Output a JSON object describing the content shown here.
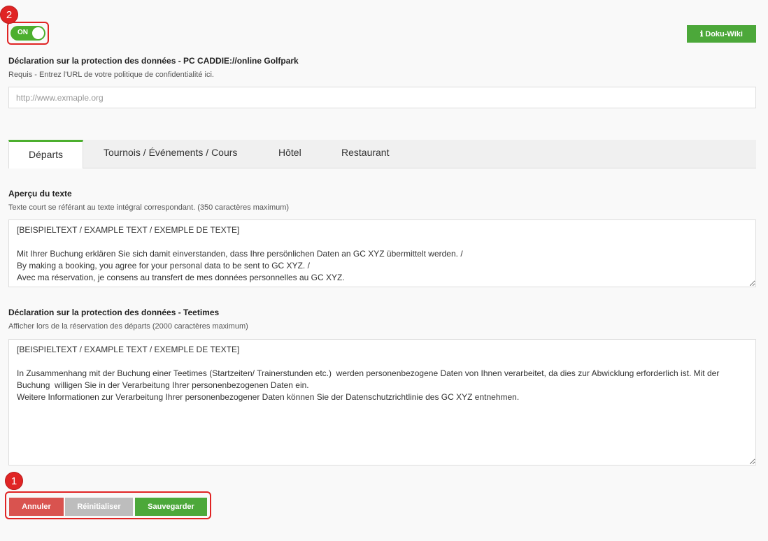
{
  "markers": {
    "one": "1",
    "two": "2"
  },
  "toggle": {
    "label": "ON",
    "state": "on"
  },
  "wiki_button": {
    "icon": "info-icon",
    "label": "ℹ Doku-Wiki"
  },
  "privacy_url": {
    "label": "Déclaration sur la protection des données - PC CADDIE://online Golfpark",
    "help": "Requis - Entrez l'URL de votre politique de confidentialité ici.",
    "placeholder": "http://www.exmaple.org",
    "value": ""
  },
  "tabs": [
    {
      "label": "Départs",
      "active": true
    },
    {
      "label": "Tournois / Événements / Cours",
      "active": false
    },
    {
      "label": "Hôtel",
      "active": false
    },
    {
      "label": "Restaurant",
      "active": false
    }
  ],
  "preview": {
    "label": "Aperçu du texte",
    "help": "Texte court se référant au texte intégral correspondant. (350 caractères maximum)",
    "value": "[BEISPIELTEXT / EXAMPLE TEXT / EXEMPLE DE TEXTE]\n\nMit Ihrer Buchung erklären Sie sich damit einverstanden, dass Ihre persönlichen Daten an GC XYZ übermittelt werden. /\nBy making a booking, you agree for your personal data to be sent to GC XYZ. /\nAvec ma réservation, je consens au transfert de mes données personnelles au GC XYZ."
  },
  "teetimes": {
    "label": "Déclaration sur la protection des données - Teetimes",
    "help": "Afficher lors de la réservation des départs (2000 caractères maximum)",
    "value": "[BEISPIELTEXT / EXAMPLE TEXT / EXEMPLE DE TEXTE]\n\nIn Zusammenhang mit der Buchung einer Teetimes (Startzeiten/ Trainerstunden etc.)  werden personenbezogene Daten von Ihnen verarbeitet, da dies zur Abwicklung erforderlich ist. Mit der Buchung  willigen Sie in der Verarbeitung Ihrer personenbezogenen Daten ein.\nWeitere Informationen zur Verarbeitung Ihrer personenbezogener Daten können Sie der Datenschutzrichtlinie des GC XYZ entnehmen."
  },
  "actions": {
    "cancel": "Annuler",
    "reset": "Réinitialiser",
    "save": "Sauvegarder"
  },
  "colors": {
    "accent_green": "#4caf2e",
    "cancel_red": "#d9534f",
    "reset_gray": "#bdbdbd",
    "marker_red": "#e02424"
  }
}
